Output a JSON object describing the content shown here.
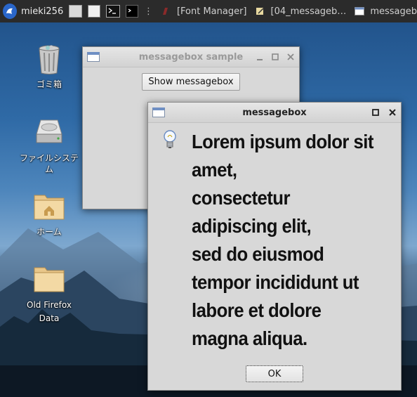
{
  "taskbar": {
    "username": "mieki256",
    "windows": [
      {
        "label": "[Font Manager]"
      },
      {
        "label": "[04_messageb…"
      },
      {
        "label": "messageb"
      }
    ]
  },
  "desktop": {
    "icons": [
      {
        "label": "ゴミ箱",
        "icon": "trash-icon"
      },
      {
        "label": "ファイルシステム",
        "icon": "drive-icon"
      },
      {
        "label": "ホーム",
        "icon": "home-folder-icon"
      },
      {
        "label": "Old Firefox\nData",
        "icon": "folder-icon"
      }
    ]
  },
  "main_window": {
    "title": "messagebox sample",
    "button_label": "Show messagebox"
  },
  "dialog": {
    "title": "messagebox",
    "message": "Lorem ipsum dolor sit\namet,\nconsectetur\nadipiscing elit,\nsed do eiusmod\ntempor incididunt ut\nlabore et dolore\nmagna aliqua.",
    "ok_label": "OK",
    "icon": "lightbulb-icon"
  }
}
